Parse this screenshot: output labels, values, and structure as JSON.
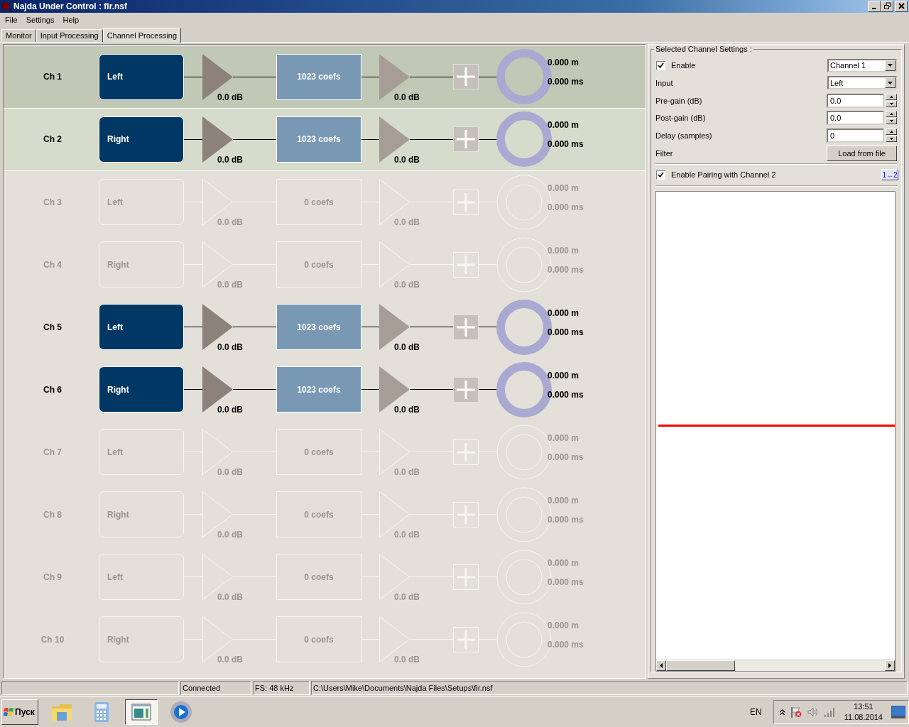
{
  "window": {
    "title": "Najda Under Control : fir.nsf"
  },
  "menu": [
    "File",
    "Settings",
    "Help"
  ],
  "tabs": [
    {
      "label": "Monitor",
      "selected": false
    },
    {
      "label": "Input Processing",
      "selected": false
    },
    {
      "label": "Channel Processing",
      "selected": true
    }
  ],
  "channels": [
    {
      "label": "Ch 1",
      "enabled": true,
      "selected": true,
      "paired": false,
      "input": "Left",
      "pre_gain": "0.0 dB",
      "filter": "1023 coefs",
      "post_gain": "0.0 dB",
      "distance": "0.000 m",
      "delay": "0.000 ms"
    },
    {
      "label": "Ch 2",
      "enabled": true,
      "selected": false,
      "paired": true,
      "input": "Right",
      "pre_gain": "0.0 dB",
      "filter": "1023 coefs",
      "post_gain": "0.0 dB",
      "distance": "0.000 m",
      "delay": "0.000 ms"
    },
    {
      "label": "Ch 3",
      "enabled": false,
      "selected": false,
      "paired": false,
      "input": "Left",
      "pre_gain": "0.0 dB",
      "filter": "0 coefs",
      "post_gain": "0.0 dB",
      "distance": "0.000 m",
      "delay": "0.000 ms"
    },
    {
      "label": "Ch 4",
      "enabled": false,
      "selected": false,
      "paired": false,
      "input": "Right",
      "pre_gain": "0.0 dB",
      "filter": "0 coefs",
      "post_gain": "0.0 dB",
      "distance": "0.000 m",
      "delay": "0.000 ms"
    },
    {
      "label": "Ch 5",
      "enabled": true,
      "selected": false,
      "paired": false,
      "input": "Left",
      "pre_gain": "0.0 dB",
      "filter": "1023 coefs",
      "post_gain": "0.0 dB",
      "distance": "0.000 m",
      "delay": "0.000 ms"
    },
    {
      "label": "Ch 6",
      "enabled": true,
      "selected": false,
      "paired": false,
      "input": "Right",
      "pre_gain": "0.0 dB",
      "filter": "1023 coefs",
      "post_gain": "0.0 dB",
      "distance": "0.000 m",
      "delay": "0.000 ms"
    },
    {
      "label": "Ch 7",
      "enabled": false,
      "selected": false,
      "paired": false,
      "input": "Left",
      "pre_gain": "0.0 dB",
      "filter": "0 coefs",
      "post_gain": "0.0 dB",
      "distance": "0.000 m",
      "delay": "0.000 ms"
    },
    {
      "label": "Ch 8",
      "enabled": false,
      "selected": false,
      "paired": false,
      "input": "Right",
      "pre_gain": "0.0 dB",
      "filter": "0 coefs",
      "post_gain": "0.0 dB",
      "distance": "0.000 m",
      "delay": "0.000 ms"
    },
    {
      "label": "Ch 9",
      "enabled": false,
      "selected": false,
      "paired": false,
      "input": "Left",
      "pre_gain": "0.0 dB",
      "filter": "0 coefs",
      "post_gain": "0.0 dB",
      "distance": "0.000 m",
      "delay": "0.000 ms"
    },
    {
      "label": "Ch 10",
      "enabled": false,
      "selected": false,
      "paired": false,
      "input": "Right",
      "pre_gain": "0.0 dB",
      "filter": "0 coefs",
      "post_gain": "0.0 dB",
      "distance": "0.000 m",
      "delay": "0.000 ms"
    }
  ],
  "settings": {
    "title": "Selected Channel Settings :",
    "enable": {
      "label": "Enable",
      "checked": true
    },
    "channel_select": "Channel 1",
    "fields": [
      {
        "kind": "dropdown",
        "label": "Input",
        "value": "Left"
      },
      {
        "kind": "spinner",
        "label": "Pre-gain (dB)",
        "value": "0.0"
      },
      {
        "kind": "spinner",
        "label": "Post-gain (dB)",
        "value": "0.0"
      },
      {
        "kind": "spinner",
        "label": "Delay (samples)",
        "value": "0"
      },
      {
        "kind": "button",
        "label": "Filter",
        "value": "Load from file"
      }
    ],
    "pairing": {
      "label": "Enable Pairing with Channel 2",
      "checked": true,
      "button": "1↔2"
    }
  },
  "status_bar": {
    "connection": "Connected",
    "sample_rate": "FS: 48 kHz",
    "path": "C:\\Users\\Mike\\Documents\\Najda Files\\Setups\\fir.nsf"
  },
  "taskbar": {
    "start": "Пуск",
    "apps": [
      {
        "kind": "folder",
        "active": false
      },
      {
        "kind": "calculator",
        "active": false
      },
      {
        "kind": "window",
        "active": true
      },
      {
        "kind": "player",
        "active": false
      }
    ],
    "language": "EN",
    "time": "13:51",
    "date": "11.08.2014"
  }
}
